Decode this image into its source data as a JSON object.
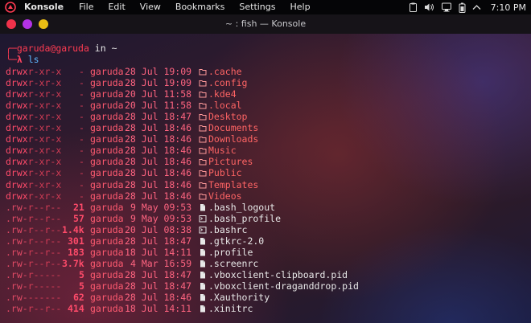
{
  "topbar": {
    "app_name": "Konsole",
    "menus": [
      "File",
      "Edit",
      "View",
      "Bookmarks",
      "Settings",
      "Help"
    ],
    "clock": "7:10 PM",
    "tray_icons": [
      "clipboard-icon",
      "volume-icon",
      "network-icon",
      "battery-icon",
      "chevron-up-icon"
    ]
  },
  "window": {
    "title": "~ : fish — Konsole"
  },
  "terminal": {
    "prompt": {
      "user": "garuda@garuda",
      "in": " in ",
      "dir": "~",
      "symbol": "λ",
      "command": "ls"
    },
    "entries": [
      {
        "perm": "drwxr-xr-x",
        "size": "-",
        "owner": "garuda",
        "date": "28 Jul 19:09",
        "icon": "folder",
        "name": ".cache",
        "type": "dir"
      },
      {
        "perm": "drwxr-xr-x",
        "size": "-",
        "owner": "garuda",
        "date": "28 Jul 19:09",
        "icon": "folder",
        "name": ".config",
        "type": "dir"
      },
      {
        "perm": "drwxr-xr-x",
        "size": "-",
        "owner": "garuda",
        "date": "20 Jul 11:58",
        "icon": "folder",
        "name": ".kde4",
        "type": "dir"
      },
      {
        "perm": "drwxr-xr-x",
        "size": "-",
        "owner": "garuda",
        "date": "20 Jul 11:58",
        "icon": "folder",
        "name": ".local",
        "type": "dir"
      },
      {
        "perm": "drwxr-xr-x",
        "size": "-",
        "owner": "garuda",
        "date": "28 Jul 18:47",
        "icon": "folder",
        "name": "Desktop",
        "type": "dir"
      },
      {
        "perm": "drwxr-xr-x",
        "size": "-",
        "owner": "garuda",
        "date": "28 Jul 18:46",
        "icon": "folder",
        "name": "Documents",
        "type": "dir"
      },
      {
        "perm": "drwxr-xr-x",
        "size": "-",
        "owner": "garuda",
        "date": "28 Jul 18:46",
        "icon": "folder",
        "name": "Downloads",
        "type": "dir"
      },
      {
        "perm": "drwxr-xr-x",
        "size": "-",
        "owner": "garuda",
        "date": "28 Jul 18:46",
        "icon": "folder",
        "name": "Music",
        "type": "dir"
      },
      {
        "perm": "drwxr-xr-x",
        "size": "-",
        "owner": "garuda",
        "date": "28 Jul 18:46",
        "icon": "folder",
        "name": "Pictures",
        "type": "dir"
      },
      {
        "perm": "drwxr-xr-x",
        "size": "-",
        "owner": "garuda",
        "date": "28 Jul 18:46",
        "icon": "folder",
        "name": "Public",
        "type": "dir"
      },
      {
        "perm": "drwxr-xr-x",
        "size": "-",
        "owner": "garuda",
        "date": "28 Jul 18:46",
        "icon": "folder",
        "name": "Templates",
        "type": "dir"
      },
      {
        "perm": "drwxr-xr-x",
        "size": "-",
        "owner": "garuda",
        "date": "28 Jul 18:46",
        "icon": "folder",
        "name": "Videos",
        "type": "dir"
      },
      {
        "perm": ".rw-r--r--",
        "size": "21",
        "owner": "garuda",
        "date": "9 May 09:53",
        "icon": "file",
        "name": ".bash_logout",
        "type": "file"
      },
      {
        "perm": ".rw-r--r--",
        "size": "57",
        "owner": "garuda",
        "date": "9 May 09:53",
        "icon": "terminal",
        "name": ".bash_profile",
        "type": "file"
      },
      {
        "perm": ".rw-r--r--",
        "size": "1.4k",
        "owner": "garuda",
        "date": "20 Jul 08:38",
        "icon": "terminal",
        "name": ".bashrc",
        "type": "file"
      },
      {
        "perm": ".rw-r--r--",
        "size": "301",
        "owner": "garuda",
        "date": "28 Jul 18:47",
        "icon": "file",
        "name": ".gtkrc-2.0",
        "type": "file"
      },
      {
        "perm": ".rw-r--r--",
        "size": "183",
        "owner": "garuda",
        "date": "18 Jul 14:11",
        "icon": "file",
        "name": ".profile",
        "type": "file"
      },
      {
        "perm": ".rw-r--r--",
        "size": "3.7k",
        "owner": "garuda",
        "date": "4 Mar 16:59",
        "icon": "file",
        "name": ".screenrc",
        "type": "file"
      },
      {
        "perm": ".rw-r-----",
        "size": "5",
        "owner": "garuda",
        "date": "28 Jul 18:47",
        "icon": "file",
        "name": ".vboxclient-clipboard.pid",
        "type": "file"
      },
      {
        "perm": ".rw-r-----",
        "size": "5",
        "owner": "garuda",
        "date": "28 Jul 18:47",
        "icon": "file",
        "name": ".vboxclient-draganddrop.pid",
        "type": "file"
      },
      {
        "perm": ".rw-------",
        "size": "62",
        "owner": "garuda",
        "date": "28 Jul 18:46",
        "icon": "file",
        "name": ".Xauthority",
        "type": "file"
      },
      {
        "perm": ".rw-r--r--",
        "size": "414",
        "owner": "garuda",
        "date": "18 Jul 14:11",
        "icon": "file",
        "name": ".xinitrc",
        "type": "file"
      }
    ]
  },
  "colors": {
    "accent_red": "#ff3b52",
    "window_close": "#f0324a",
    "window_min": "#b432e6",
    "window_max": "#ebbe14",
    "command_blue": "#5fb8ff"
  }
}
